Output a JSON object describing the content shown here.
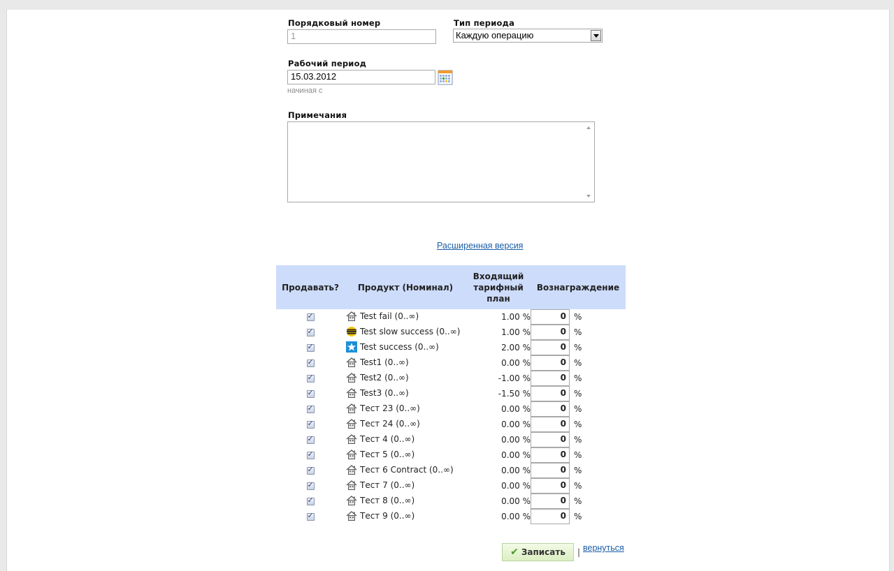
{
  "form": {
    "order_number": {
      "label": "Порядковый номер",
      "value": "1"
    },
    "period_type": {
      "label": "Тип периода",
      "selected": "Каждую операцию"
    },
    "work_period": {
      "label": "Рабочий период",
      "value": "15.03.2012",
      "hint": "начиная с"
    },
    "notes": {
      "label": "Примечания",
      "value": ""
    },
    "extended_link": "Расширенная версия"
  },
  "table": {
    "headers": {
      "sell": "Продавать?",
      "product": "Продукт (Номинал)",
      "rate": "Входящий тарифный план",
      "reward": "Вознаграждение"
    },
    "rows": [
      {
        "product": "Test fail (0..∞)",
        "icon": "house-icon",
        "rate": "1.00 %",
        "reward": "0",
        "unit": "%",
        "checked": true
      },
      {
        "product": "Test slow success (0..∞)",
        "icon": "beeline-icon",
        "rate": "1.00 %",
        "reward": "0",
        "unit": "%",
        "checked": true
      },
      {
        "product": "Test success (0..∞)",
        "icon": "star-icon",
        "rate": "2.00 %",
        "reward": "0",
        "unit": "%",
        "checked": true
      },
      {
        "product": "Test1 (0..∞)",
        "icon": "house-icon",
        "rate": "0.00 %",
        "reward": "0",
        "unit": "%",
        "checked": true
      },
      {
        "product": "Test2 (0..∞)",
        "icon": "house-icon",
        "rate": "-1.00 %",
        "reward": "0",
        "unit": "%",
        "checked": true
      },
      {
        "product": "Test3 (0..∞)",
        "icon": "house-icon",
        "rate": "-1.50 %",
        "reward": "0",
        "unit": "%",
        "checked": true
      },
      {
        "product": "Тест 23 (0..∞)",
        "icon": "house-icon",
        "rate": "0.00 %",
        "reward": "0",
        "unit": "%",
        "checked": true
      },
      {
        "product": "Тест 24 (0..∞)",
        "icon": "house-icon",
        "rate": "0.00 %",
        "reward": "0",
        "unit": "%",
        "checked": true
      },
      {
        "product": "Тест 4 (0..∞)",
        "icon": "house-icon",
        "rate": "0.00 %",
        "reward": "0",
        "unit": "%",
        "checked": true
      },
      {
        "product": "Тест 5 (0..∞)",
        "icon": "house-icon",
        "rate": "0.00 %",
        "reward": "0",
        "unit": "%",
        "checked": true
      },
      {
        "product": "Тест 6 Contract (0..∞)",
        "icon": "house-icon",
        "rate": "0.00 %",
        "reward": "0",
        "unit": "%",
        "checked": true
      },
      {
        "product": "Тест 7 (0..∞)",
        "icon": "house-icon",
        "rate": "0.00 %",
        "reward": "0",
        "unit": "%",
        "checked": true
      },
      {
        "product": "Тест 8 (0..∞)",
        "icon": "house-icon",
        "rate": "0.00 %",
        "reward": "0",
        "unit": "%",
        "checked": true
      },
      {
        "product": "Тест 9 (0..∞)",
        "icon": "house-icon",
        "rate": "0.00 %",
        "reward": "0",
        "unit": "%",
        "checked": true
      }
    ]
  },
  "actions": {
    "save_label": "Записать",
    "separator": "|",
    "back_label": "вернуться"
  },
  "colors": {
    "header_bg": "#cddcfb",
    "link": "#1a5ea8",
    "save_bg": "#dcefc3"
  }
}
